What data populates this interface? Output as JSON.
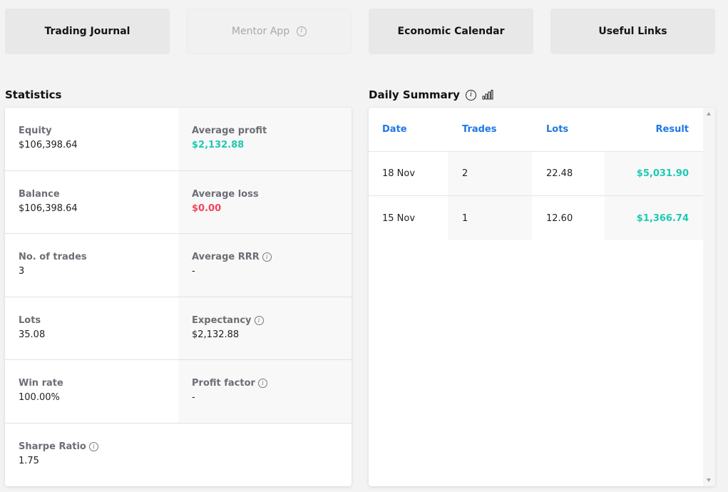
{
  "nav": {
    "trading_journal": "Trading Journal",
    "mentor_app": "Mentor App",
    "economic_calendar": "Economic Calendar",
    "useful_links": "Useful Links"
  },
  "statistics": {
    "title": "Statistics",
    "cells": [
      {
        "label": "Equity",
        "value": "$106,398.64"
      },
      {
        "label": "Average profit",
        "value": "$2,132.88"
      },
      {
        "label": "Balance",
        "value": "$106,398.64"
      },
      {
        "label": "Average loss",
        "value": "$0.00"
      },
      {
        "label": "No. of trades",
        "value": "3"
      },
      {
        "label": "Average RRR",
        "value": "-"
      },
      {
        "label": "Lots",
        "value": "35.08"
      },
      {
        "label": "Expectancy",
        "value": "$2,132.88"
      },
      {
        "label": "Win rate",
        "value": "100.00%"
      },
      {
        "label": "Profit factor",
        "value": "-"
      },
      {
        "label": "Sharpe Ratio",
        "value": "1.75"
      }
    ]
  },
  "daily_summary": {
    "title": "Daily Summary",
    "columns": [
      "Date",
      "Trades",
      "Lots",
      "Result"
    ],
    "rows": [
      {
        "date": "18 Nov",
        "trades": "2",
        "lots": "22.48",
        "result": "$5,031.90"
      },
      {
        "date": "15 Nov",
        "trades": "1",
        "lots": "12.60",
        "result": "$1,366.74"
      }
    ]
  },
  "icons": {
    "info": "info-icon",
    "chart": "bar-chart-icon"
  },
  "colors": {
    "positive": "#1ec9b4",
    "negative": "#f2445a",
    "header_blue": "#1d78e6"
  }
}
